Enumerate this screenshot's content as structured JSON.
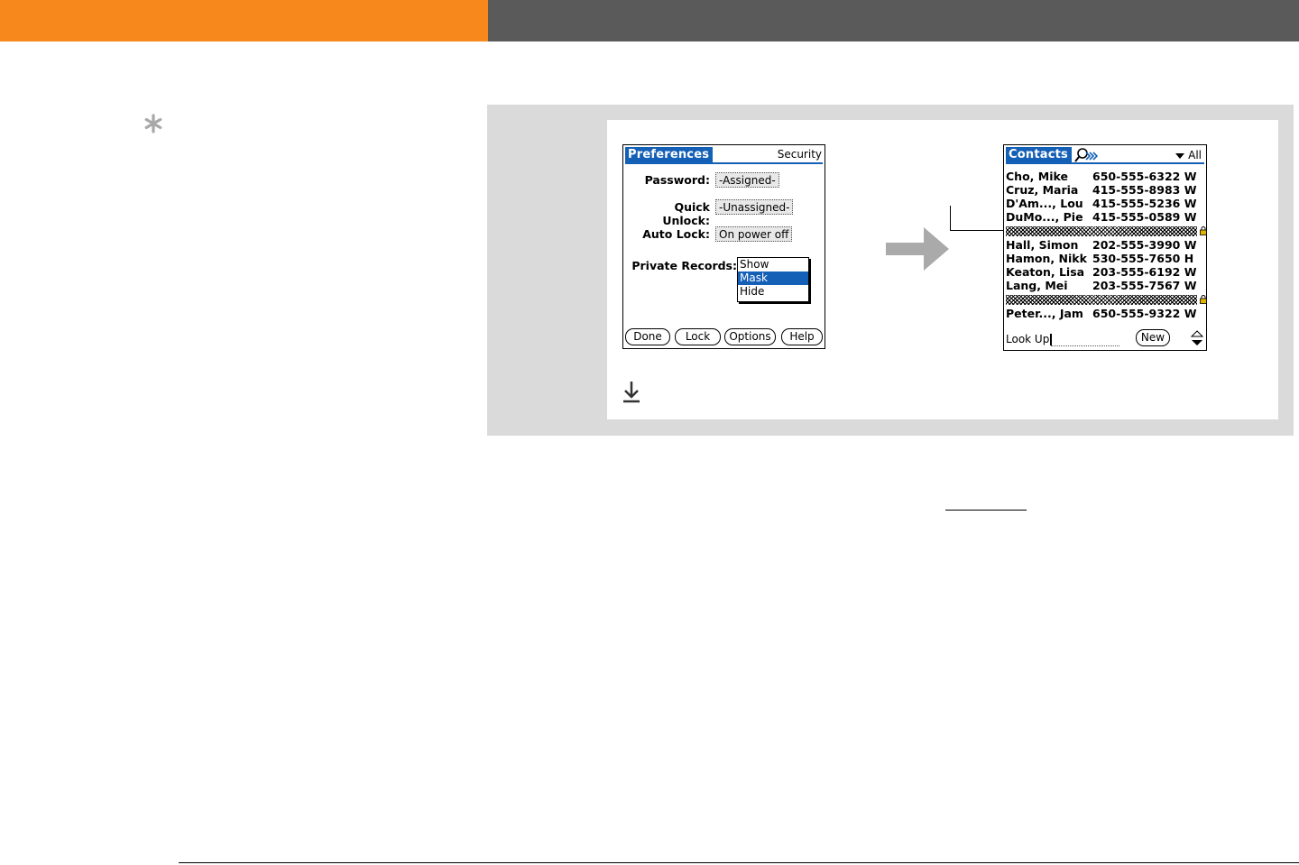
{
  "colors": {
    "header_orange": "#f7891c",
    "header_gray": "#5a5a5a",
    "palm_blue": "#1560b7",
    "step_gray": "#dadada"
  },
  "tip": {
    "icon": "asterisk-icon"
  },
  "preferences": {
    "title": "Preferences",
    "section": "Security",
    "password_label": "Password:",
    "password_value": "-Assigned-",
    "quick_unlock_label": "Quick Unlock:",
    "quick_unlock_value": "-Unassigned-",
    "auto_lock_label": "Auto Lock:",
    "auto_lock_value": "On power off",
    "private_records_label": "Private Records:",
    "private_records_options": [
      "Show",
      "Mask",
      "Hide"
    ],
    "private_records_selected": "Mask",
    "buttons": [
      "Done",
      "Lock",
      "Options",
      "Help"
    ]
  },
  "contacts": {
    "title": "Contacts",
    "category": "All",
    "rows": [
      {
        "name": "Cho, Mike",
        "phone": "650-555-6322 W"
      },
      {
        "name": "Cruz, Maria",
        "phone": "415-555-8983 W"
      },
      {
        "name": "D'Am..., Lou",
        "phone": "415-555-5236 W"
      },
      {
        "name": "DuMo..., Pie",
        "phone": "415-555-0589 W"
      },
      {
        "name": "Hall, Simon",
        "phone": "202-555-3990 W"
      },
      {
        "name": "Hamon, Nikk",
        "phone": "530-555-7650 H"
      },
      {
        "name": "Keaton, Lisa",
        "phone": "203-555-6192 W"
      },
      {
        "name": "Lang, Mei",
        "phone": "203-555-7567 W"
      },
      {
        "name": "Peter..., Jam",
        "phone": "650-555-9322 W"
      }
    ],
    "lookup_label": "Look Up:",
    "new_button": "New"
  }
}
